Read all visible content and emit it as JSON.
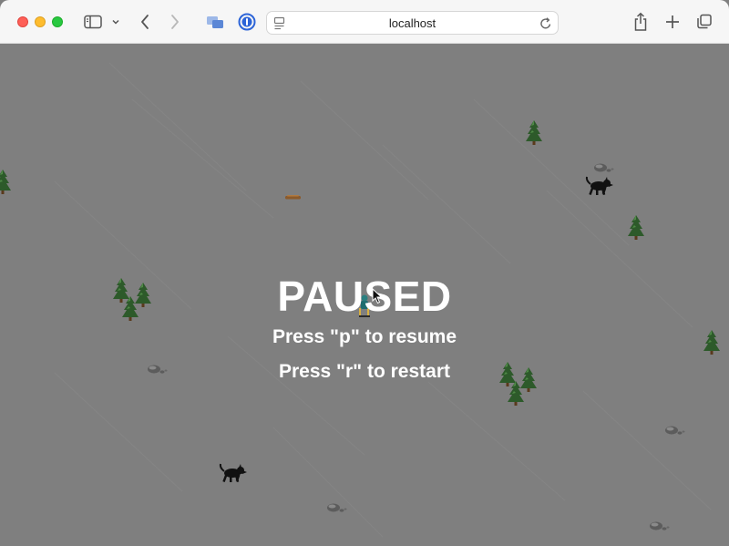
{
  "browser": {
    "url": "localhost",
    "colors": {
      "chrome_bg": "#f6f6f6",
      "close": "#fe5f57",
      "minimize": "#febc2e",
      "zoom": "#28c840"
    }
  },
  "game": {
    "background_color": "#7f7f7f",
    "state": "paused",
    "overlay": {
      "title": "PAUSED",
      "resume_hint": "Press \"p\" to resume",
      "restart_hint": "Press \"r\" to restart"
    },
    "sprites": [
      "tree",
      "rock",
      "dog",
      "log",
      "skier"
    ]
  }
}
